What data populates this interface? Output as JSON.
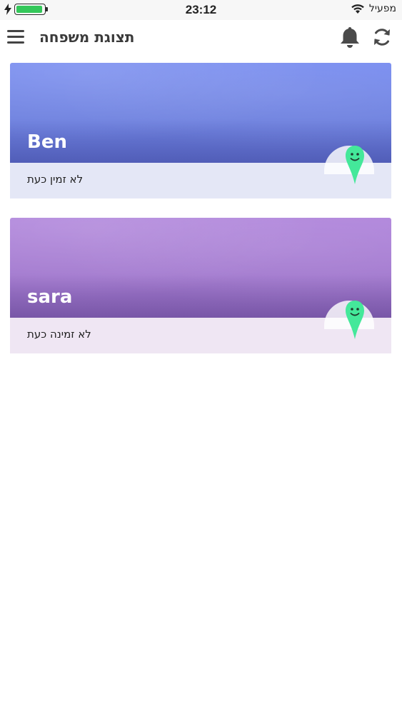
{
  "status_bar": {
    "time": "23:12",
    "carrier": "מפעיל",
    "icons": [
      "bolt-icon",
      "battery-icon",
      "wifi-icon"
    ],
    "battery_color": "#33c759"
  },
  "header": {
    "title": "תצוגת משפחה",
    "icons": [
      "menu-icon",
      "bell-icon",
      "refresh-icon"
    ]
  },
  "members": [
    {
      "name": "Ben",
      "status": "לא זמין כעת",
      "banner_color": "#6f82e0",
      "footer_color": "#e4e7f6",
      "avatar_icon": "smiley-pin-icon"
    },
    {
      "name": "sara",
      "status": "לא זמינה כעת",
      "banner_color": "#a47bd0",
      "footer_color": "#efe6f3",
      "avatar_icon": "smiley-pin-icon"
    }
  ],
  "colors": {
    "pin": "#44e89a",
    "header_text": "#3a3a3a"
  }
}
